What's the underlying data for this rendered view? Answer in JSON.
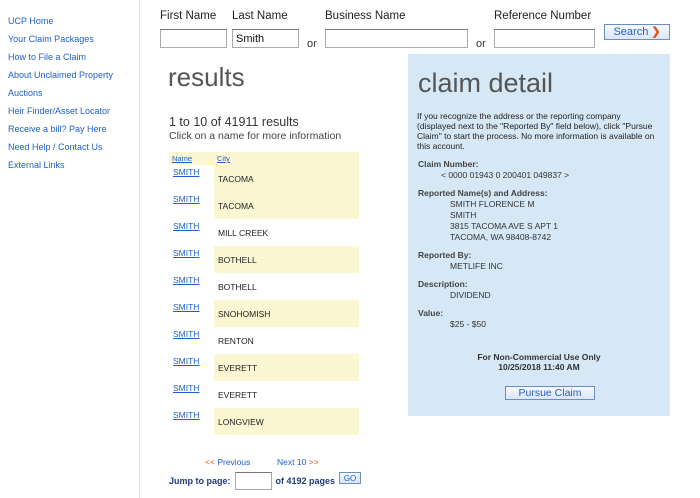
{
  "sidebar": {
    "items": [
      {
        "label": "UCP Home"
      },
      {
        "label": "Your Claim Packages"
      },
      {
        "label": "How to File a Claim"
      },
      {
        "label": "About Unclaimed Property"
      },
      {
        "label": "Auctions"
      },
      {
        "label": "Heir Finder/Asset Locator"
      },
      {
        "label": "Receive a bill? Pay Here"
      },
      {
        "label": "Need Help / Contact Us"
      },
      {
        "label": "External Links"
      }
    ]
  },
  "search": {
    "first_name_label": "First Name",
    "last_name_label": "Last Name",
    "business_name_label": "Business Name",
    "reference_number_label": "Reference Number",
    "first_name_value": "",
    "last_name_value": "Smith",
    "business_name_value": "",
    "reference_number_value": "",
    "or_text": "or",
    "button_label": "Search",
    "button_icon": "chevron-right-icon"
  },
  "results": {
    "title": "results",
    "count_text": "1 to 10 of 41911 results",
    "hint": "Click on a name for more information",
    "columns": {
      "name": "Name",
      "city": "City"
    },
    "rows": [
      {
        "name": "SMITH",
        "city": "TACOMA"
      },
      {
        "name": "SMITH",
        "city": "TACOMA"
      },
      {
        "name": "SMITH",
        "city": "MILL CREEK"
      },
      {
        "name": "SMITH",
        "city": "BOTHELL"
      },
      {
        "name": "SMITH",
        "city": "BOTHELL"
      },
      {
        "name": "SMITH",
        "city": "SNOHOMISH"
      },
      {
        "name": "SMITH",
        "city": "RENTON"
      },
      {
        "name": "SMITH",
        "city": "EVERETT"
      },
      {
        "name": "SMITH",
        "city": "EVERETT"
      },
      {
        "name": "SMITH",
        "city": "LONGVIEW"
      }
    ],
    "pager": {
      "prev_chevron": "<<",
      "prev_label": "Previous",
      "next_label": "Next 10",
      "next_chevron": ">>"
    },
    "jump": {
      "label": "Jump to page:",
      "value": "",
      "of_pages": "of 4192 pages",
      "go_label": "GO"
    }
  },
  "detail": {
    "title": "claim detail",
    "intro": "If you recognize the address or the reporting company (displayed next to the \"Reported By\" field below), click \"Pursue Claim\" to start the process. No more information is available on this account.",
    "claim_number_label": "Claim Number:",
    "claim_number": "< 0000 01943 0 200401 049837 >",
    "reported_names_label": "Reported Name(s) and Address:",
    "address_lines": [
      "SMITH FLORENCE M",
      "SMITH",
      "3815 TACOMA AVE S APT 1",
      "TACOMA, WA 98408-8742"
    ],
    "reported_by_label": "Reported By:",
    "reported_by": "METLIFE INC",
    "description_label": "Description:",
    "description": "DIVIDEND",
    "value_label": "Value:",
    "value": "$25 - $50",
    "footer_line1": "For Non-Commercial Use Only",
    "footer_line2": "10/25/2018 11:40 AM",
    "pursue_label": "Pursue Claim"
  }
}
